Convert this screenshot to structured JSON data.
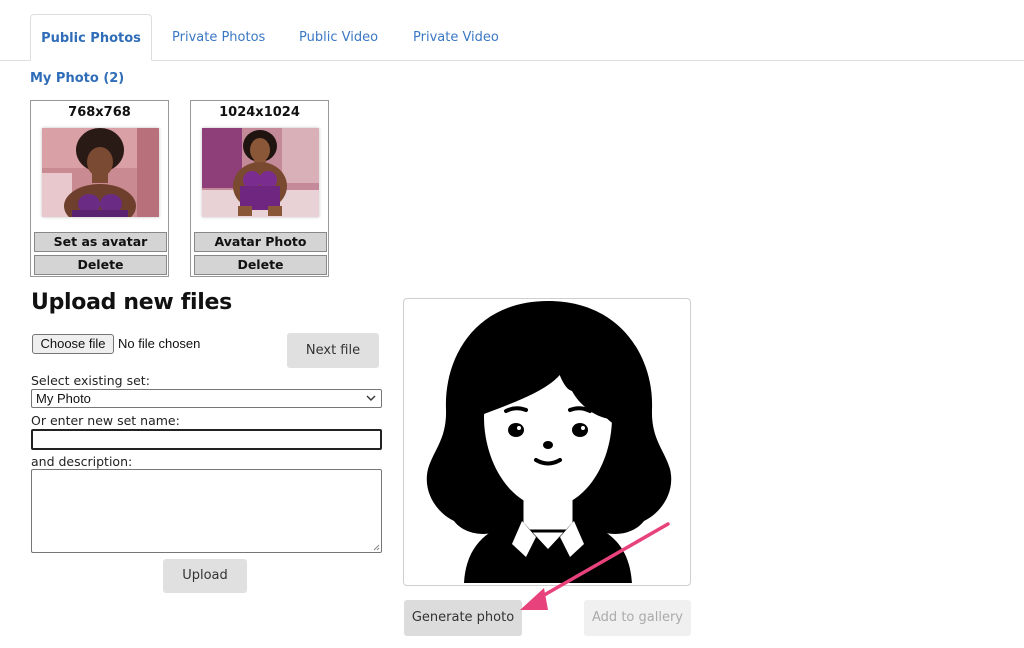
{
  "tabs": [
    {
      "label": "Public Photos",
      "active": true
    },
    {
      "label": "Private Photos",
      "active": false
    },
    {
      "label": "Public Video",
      "active": false
    },
    {
      "label": "Private Video",
      "active": false
    }
  ],
  "photo_set": {
    "title": "My Photo (2)"
  },
  "photos": [
    {
      "size": "768x768",
      "button1": "Set as avatar",
      "button2": "Delete"
    },
    {
      "size": "1024x1024",
      "button1": "Avatar Photo",
      "button2": "Delete"
    }
  ],
  "upload": {
    "title": "Upload new files",
    "choose_file": "Choose file",
    "no_file": "No file chosen",
    "next_file": "Next file",
    "select_label": "Select existing set:",
    "select_value": "My Photo",
    "new_set_label": "Or enter new set name:",
    "new_set_value": "",
    "description_label": "and description:",
    "description_value": "",
    "upload_button": "Upload"
  },
  "generator": {
    "generate_button": "Generate photo",
    "add_gallery_button": "Add to gallery",
    "add_gallery_enabled": false
  },
  "colors": {
    "link": "#2f6db8",
    "arrow": "#e8427c",
    "button_bg": "#dcdcdc"
  }
}
